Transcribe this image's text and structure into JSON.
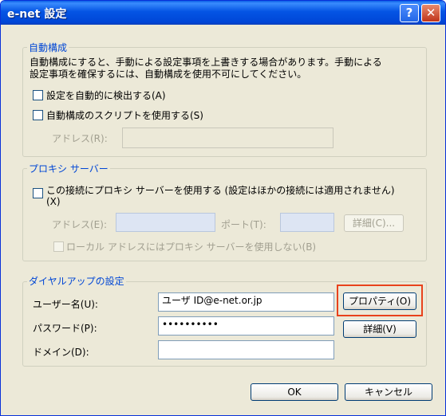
{
  "window": {
    "title": "e-net 設定"
  },
  "auto": {
    "group_label": "自動構成",
    "desc1": "自動構成にすると、手動による設定事項を上書きする場合があります。手動による",
    "desc2": "設定事項を確保するには、自動構成を使用不可にしてください。",
    "detect_label": "設定を自動的に検出する(A)",
    "script_label": "自動構成のスクリプトを使用する(S)",
    "address_label": "アドレス(R):",
    "address_value": ""
  },
  "proxy": {
    "group_label": "プロキシ サーバー",
    "use_label_1": "この接続にプロキシ サーバーを使用する (設定はほかの接続には適用されません)",
    "use_label_2": "(X)",
    "address_label": "アドレス(E):",
    "address_value": "",
    "port_label": "ポート(T):",
    "port_value": "",
    "details_button": "詳細(C)...",
    "bypass_label": "ローカル アドレスにはプロキシ サーバーを使用しない(B)"
  },
  "dialup": {
    "group_label": "ダイヤルアップの設定",
    "username_label": "ユーザー名(U):",
    "username_value": "ユーザ ID@e-net.or.jp",
    "password_label": "パスワード(P):",
    "password_value": "••••••••••",
    "domain_label": "ドメイン(D):",
    "domain_value": "",
    "properties_button": "プロパティ(O)",
    "details_button": "詳細(V)"
  },
  "footer": {
    "ok_button": "OK",
    "cancel_button": "キャンセル"
  },
  "colors": {
    "title_bar": "#0054e3",
    "group_label": "#0046d5",
    "highlight_box": "#e8421c"
  }
}
